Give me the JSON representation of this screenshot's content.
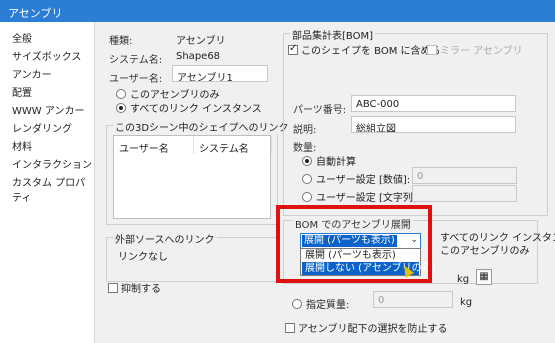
{
  "window": {
    "title": "アセンブリ"
  },
  "sidebar": {
    "items": [
      {
        "label": "全般"
      },
      {
        "label": "サイズボックス"
      },
      {
        "label": "アンカー"
      },
      {
        "label": "配置"
      },
      {
        "label": "WWW アンカー"
      },
      {
        "label": "レンダリング"
      },
      {
        "label": "材料"
      },
      {
        "label": "インタラクション"
      },
      {
        "label": "カスタム プロパティ"
      }
    ]
  },
  "general": {
    "type_label": "種類:",
    "type_value": "アセンブリ",
    "system_name_label": "システム名:",
    "system_name_value": "Shape68",
    "user_name_label": "ユーザー名:",
    "user_name_value": "アセンブリ1",
    "radio_this_assembly": "このアセンブリのみ",
    "radio_all_instances": "すべてのリンク インスタンス",
    "links_group_title": "この3Dシーン中のシェイプへのリンク",
    "links_col_user_name": "ユーザー名",
    "links_col_system_name": "システム名",
    "ext_source_title": "外部ソースへのリンク",
    "ext_source_value": "リンクなし",
    "suppress_label": "抑制する"
  },
  "bom": {
    "group_title": "部品集計表[BOM]",
    "include_label": "このシェイプを BOM に含める",
    "mirror_label": "ミラー アセンブリ",
    "part_number_label": "パーツ番号:",
    "part_number_value": "ABC-000",
    "description_label": "説明:",
    "description_value": "総組立図",
    "quantity_label": "数量:",
    "qty_auto": "自動計算",
    "qty_user_number": "ユーザー設定 [数値]:",
    "qty_user_number_value": "0",
    "qty_user_text": "ユーザー設定 [文字列]:",
    "expand_title": "BOM でのアセンブリ展開",
    "expand_selected": "展開 (パーツも表示)",
    "expand_options": [
      "展開 (パーツも表示)",
      "展開しない (アセンブリのみ)"
    ],
    "scope_all": "すべてのリンク インスタンス",
    "scope_this": "このアセンブリのみ"
  },
  "mass": {
    "unit_kg": "kg",
    "specified_label": "指定質量:",
    "specified_value": "0",
    "prevent_label": "アセンブリ配下の選択を防止する"
  }
}
